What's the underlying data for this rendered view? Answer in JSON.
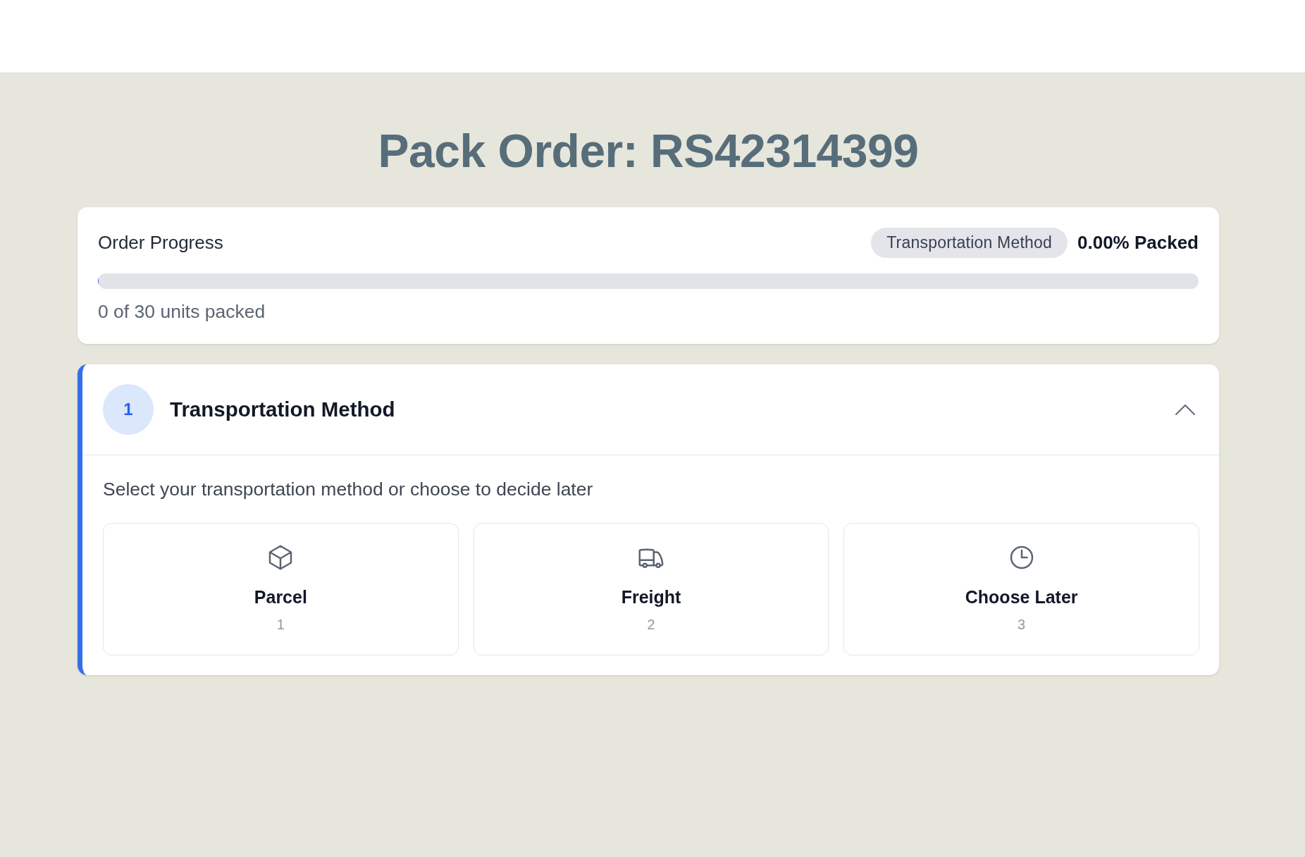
{
  "page": {
    "title": "Pack Order: RS42314399"
  },
  "progress": {
    "label": "Order Progress",
    "badge": "Transportation Method",
    "percent": "0.00% Packed",
    "level": 0,
    "units": "0 of 30 units packed"
  },
  "steps": [
    {
      "number": "1",
      "title": "Transportation Method",
      "active": true,
      "expanded": true,
      "description": "Select your transportation method or choose to decide later",
      "options": [
        {
          "kind": "box",
          "label": "Parcel",
          "count": "1",
          "selected": false
        },
        {
          "kind": "truck",
          "label": "Freight",
          "count": "2",
          "selected": false
        },
        {
          "kind": "clock",
          "label": "Choose Later",
          "count": "3",
          "selected": false
        }
      ]
    }
  ]
}
